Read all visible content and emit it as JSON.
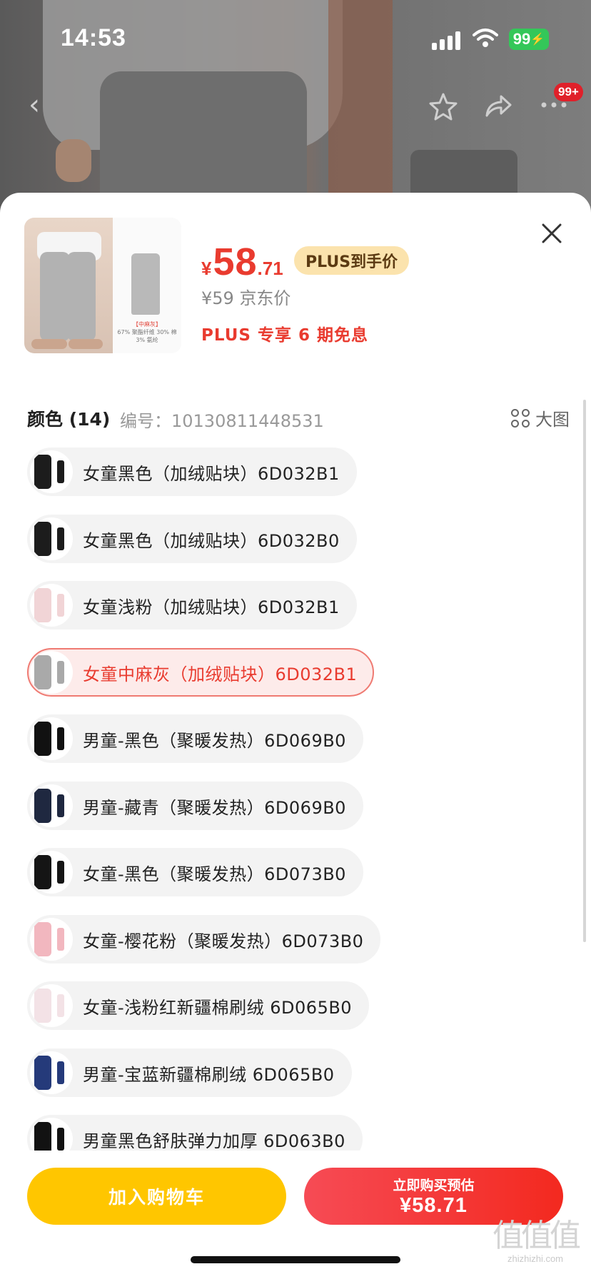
{
  "status_bar": {
    "time": "14:53",
    "battery": "99"
  },
  "nav": {
    "cart_badge": "99+"
  },
  "product": {
    "price_currency": "¥",
    "price_int": "58",
    "price_dec": ".71",
    "plus_tag": "PLUS到手价",
    "jd_price": "¥59 京东价",
    "plus_promo": "PLUS 专享 6 期免息",
    "thumb_caption_1": "【中麻灰】",
    "thumb_caption_2": "67% 聚酯纤维 30% 棉",
    "thumb_caption_3": "3% 氨纶"
  },
  "color_section": {
    "title": "颜色 (14)",
    "sku": "编号：10130811448531",
    "bigpic_label": "大图"
  },
  "options": [
    {
      "label": "女童黑色（加绒贴块）6D032B1",
      "swatch": "#1c1c1c",
      "selected": false
    },
    {
      "label": "女童黑色（加绒贴块）6D032B0",
      "swatch": "#1c1c1c",
      "selected": false
    },
    {
      "label": "女童浅粉（加绒贴块）6D032B1",
      "swatch": "#f1d4d6",
      "selected": false
    },
    {
      "label": "女童中麻灰（加绒贴块）6D032B1",
      "swatch": "#a9a9a9",
      "selected": true
    },
    {
      "label": "男童-黑色（聚暖发热）6D069B0",
      "swatch": "#111111",
      "selected": false
    },
    {
      "label": "男童-藏青（聚暖发热）6D069B0",
      "swatch": "#1f2840",
      "selected": false
    },
    {
      "label": "女童-黑色（聚暖发热）6D073B0",
      "swatch": "#151515",
      "selected": false
    },
    {
      "label": "女童-樱花粉（聚暖发热）6D073B0",
      "swatch": "#f2b7bf",
      "selected": false
    },
    {
      "label": "女童-浅粉红新疆棉刷绒 6D065B0",
      "swatch": "#f3e2e6",
      "selected": false
    },
    {
      "label": "男童-宝蓝新疆棉刷绒 6D065B0",
      "swatch": "#253a7a",
      "selected": false
    },
    {
      "label": "男童黑色舒肤弹力加厚 6D063B0",
      "swatch": "#121212",
      "selected": false
    }
  ],
  "actions": {
    "add_to_cart": "加入购物车",
    "buy_now_line1": "立即购买预估",
    "buy_now_line2": "¥58.71"
  },
  "watermark": {
    "logo": "值值值",
    "site": "zhizhizhi.com"
  },
  "colors": {
    "accent_red": "#e93b2f",
    "cart_yellow": "#ffc600",
    "plus_gold": "#fbe3ad"
  }
}
